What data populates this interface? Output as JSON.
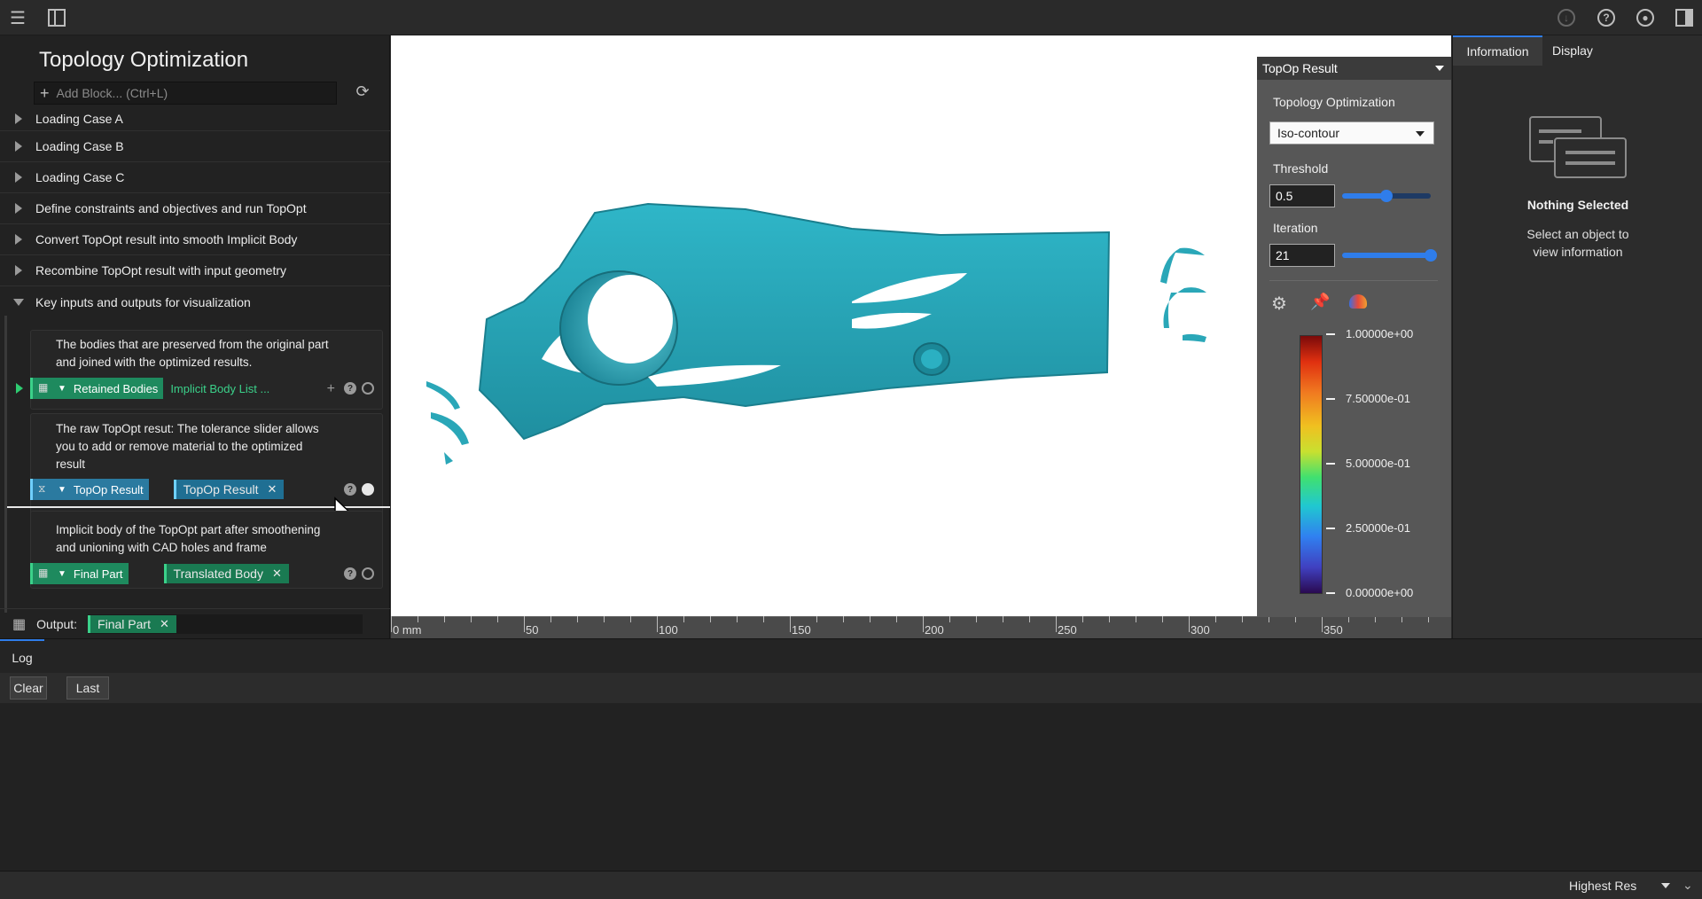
{
  "window": {
    "panel_title": "Topology Optimization"
  },
  "add_block": {
    "placeholder": "Add Block... (Ctrl+L)"
  },
  "tree": [
    {
      "label": "Loading Case A",
      "expanded": false
    },
    {
      "label": "Loading Case B",
      "expanded": false
    },
    {
      "label": "Loading Case C",
      "expanded": false
    },
    {
      "label": "Define constraints and objectives and run TopOpt",
      "expanded": false
    },
    {
      "label": "Convert TopOpt result into smooth Implicit Body",
      "expanded": false
    },
    {
      "label": "Recombine TopOpt result with input geometry",
      "expanded": false
    },
    {
      "label": "Key inputs and outputs for visualization",
      "expanded": true
    }
  ],
  "cards": [
    {
      "description": [
        "The bodies that are preserved from the original part",
        "and joined with the optimized results."
      ],
      "port_label": "Retained Bodies",
      "value": "Implicit Body List ..."
    },
    {
      "description": [
        "The raw TopOpt resut: The tolerance slider allows",
        "you to add or remove material to the optimized",
        "result"
      ],
      "port_label": "TopOp Result",
      "value": "TopOp Result"
    },
    {
      "description": [
        "Implicit body of the TopOpt part after smoothening",
        "and unioning with CAD holes and frame"
      ],
      "port_label": "Final Part",
      "value": "Translated Body"
    }
  ],
  "output": {
    "label": "Output:",
    "value": "Final Part"
  },
  "ruler": {
    "labels": [
      "0 mm",
      "50",
      "100",
      "150",
      "200",
      "250",
      "300",
      "350"
    ]
  },
  "render_panel": {
    "title": "TopOp Result",
    "section": "Topology Optimization",
    "mode": "Iso-contour",
    "threshold_label": "Threshold",
    "threshold_value": "0.5",
    "threshold_fraction": 0.5,
    "iteration_label": "Iteration",
    "iteration_value": "21",
    "iteration_fraction": 1.0,
    "colorbar": [
      "1.00000e+00",
      "7.50000e-01",
      "5.00000e-01",
      "2.50000e-01",
      "0.00000e+00"
    ]
  },
  "info_panel": {
    "tabs": [
      "Information",
      "Display"
    ],
    "heading": "Nothing Selected",
    "message": [
      "Select an object to",
      "view information"
    ]
  },
  "log": {
    "tab": "Log",
    "clear": "Clear",
    "last": "Last"
  },
  "status": {
    "resolution": "Highest Res"
  },
  "colors": {
    "accent": "#2f7dea",
    "port_green": "#1e8a5e",
    "port_blue": "#2b7aa0",
    "model": "#2aa7b8"
  }
}
